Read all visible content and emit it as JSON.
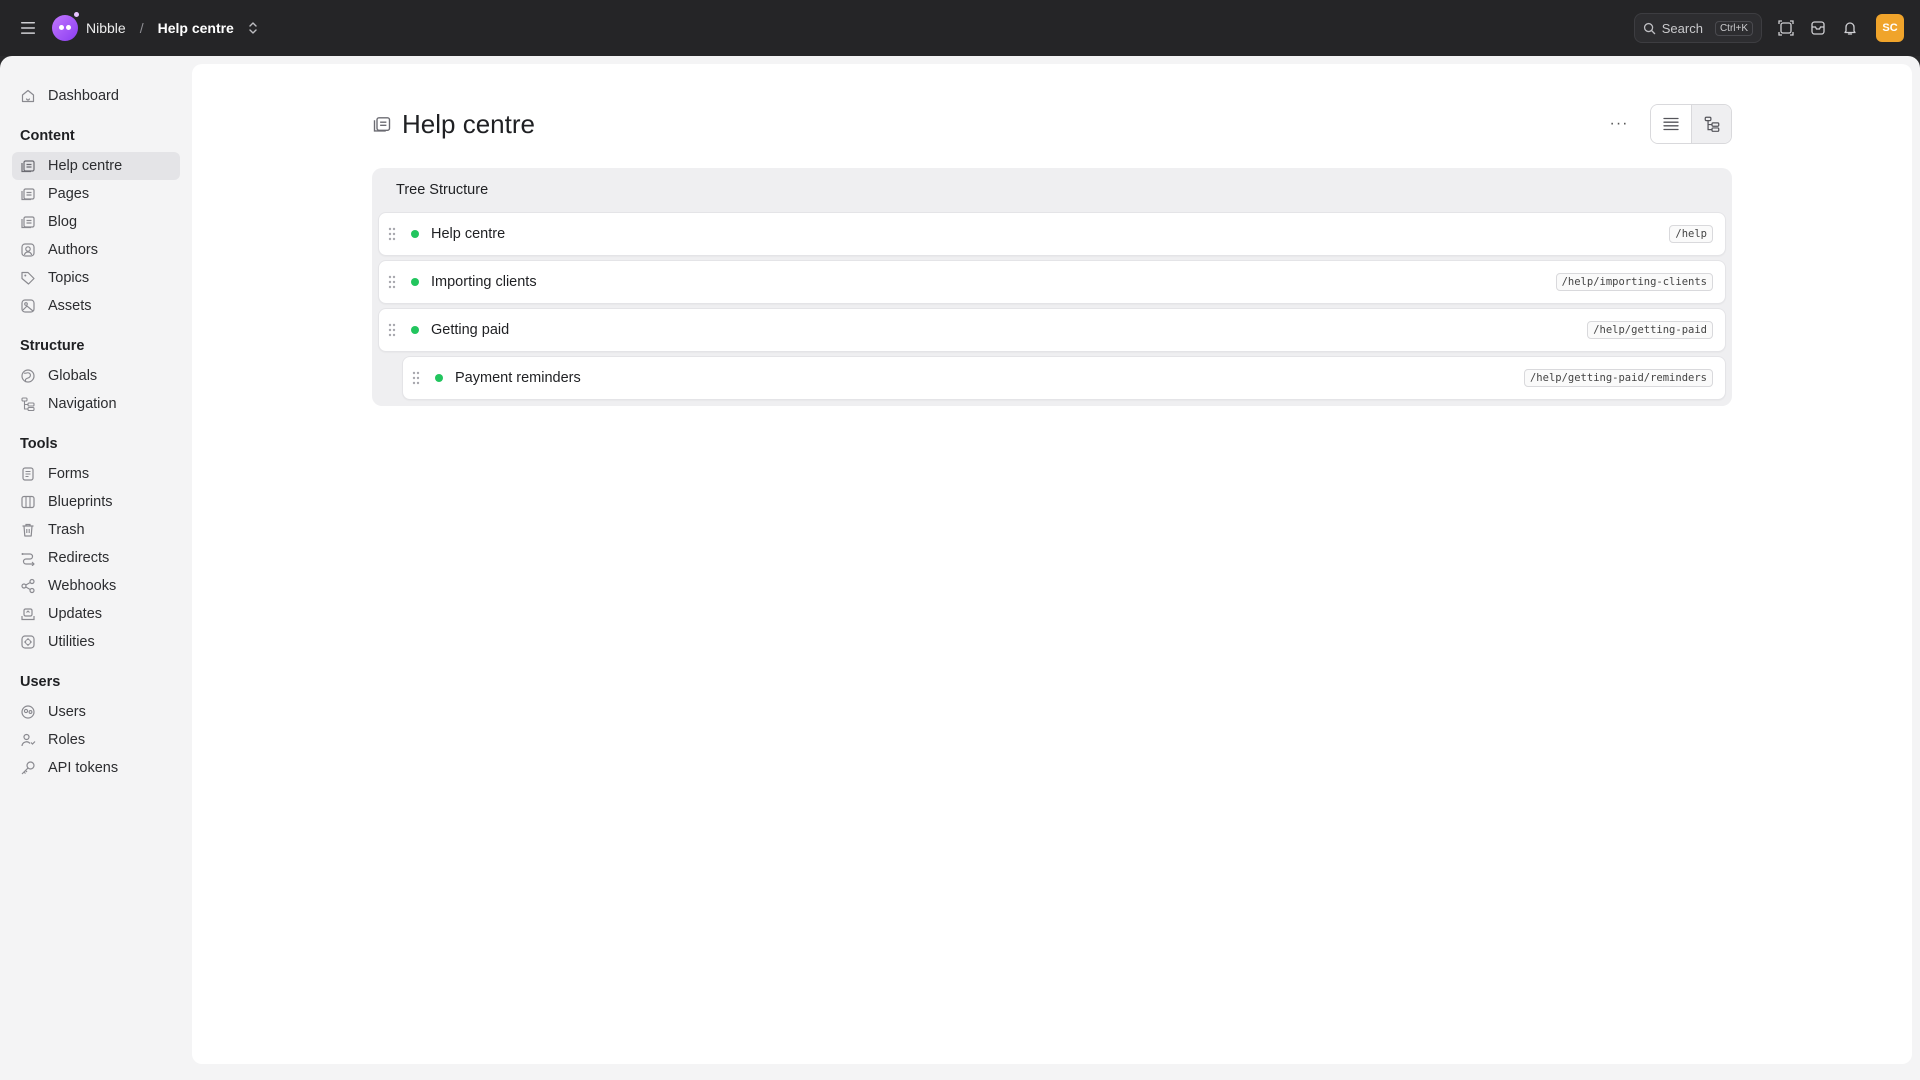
{
  "topbar": {
    "site_name": "Nibble",
    "separator": "/",
    "section": "Help centre",
    "search_label": "Search",
    "search_shortcut": "Ctrl+K",
    "avatar_initials": "SC",
    "avatar_color": "#f0a42b"
  },
  "sidebar": {
    "dashboard": "Dashboard",
    "groups": [
      {
        "title": "Content",
        "items": [
          {
            "label": "Help centre",
            "icon": "collection-icon",
            "active": true
          },
          {
            "label": "Pages",
            "icon": "collection-icon"
          },
          {
            "label": "Blog",
            "icon": "collection-icon"
          },
          {
            "label": "Authors",
            "icon": "user-circle-icon"
          },
          {
            "label": "Topics",
            "icon": "tag-icon"
          },
          {
            "label": "Assets",
            "icon": "assets-icon"
          }
        ]
      },
      {
        "title": "Structure",
        "items": [
          {
            "label": "Globals",
            "icon": "globe-icon"
          },
          {
            "label": "Navigation",
            "icon": "navigation-icon"
          }
        ]
      },
      {
        "title": "Tools",
        "items": [
          {
            "label": "Forms",
            "icon": "form-icon"
          },
          {
            "label": "Blueprints",
            "icon": "blueprint-icon"
          },
          {
            "label": "Trash",
            "icon": "trash-icon"
          },
          {
            "label": "Redirects",
            "icon": "redirect-icon"
          },
          {
            "label": "Webhooks",
            "icon": "webhook-icon"
          },
          {
            "label": "Updates",
            "icon": "updates-icon"
          },
          {
            "label": "Utilities",
            "icon": "utilities-icon"
          }
        ]
      },
      {
        "title": "Users",
        "items": [
          {
            "label": "Users",
            "icon": "users-icon"
          },
          {
            "label": "Roles",
            "icon": "roles-icon"
          },
          {
            "label": "API tokens",
            "icon": "key-icon"
          }
        ]
      }
    ]
  },
  "page": {
    "title": "Help centre",
    "more_label": "···"
  },
  "tree": {
    "title": "Tree Structure",
    "status_color": "#22c55e",
    "rows": [
      {
        "label": "Help centre",
        "slug": "/help",
        "depth": 0
      },
      {
        "label": "Importing clients",
        "slug": "/help/importing-clients",
        "depth": 0
      },
      {
        "label": "Getting paid",
        "slug": "/help/getting-paid",
        "depth": 0
      },
      {
        "label": "Payment reminders",
        "slug": "/help/getting-paid/reminders",
        "depth": 1
      }
    ]
  }
}
